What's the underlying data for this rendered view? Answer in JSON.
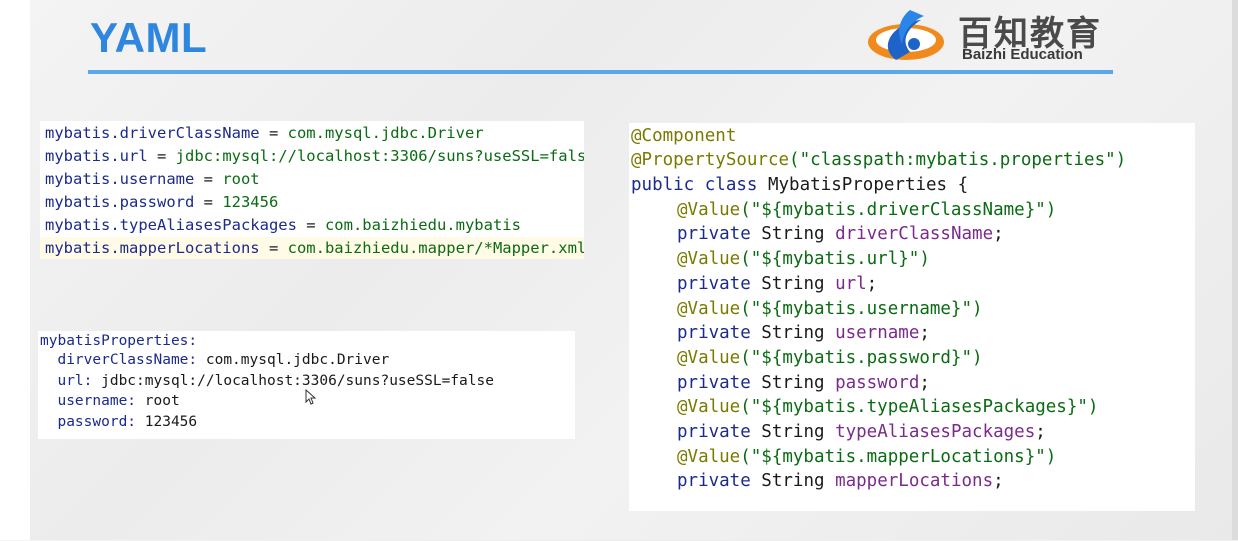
{
  "slide": {
    "title": "YAML"
  },
  "logo": {
    "name_cn": "百知教育",
    "name_en": "Baizhi Education"
  },
  "properties_file": {
    "lines": [
      {
        "key": "mybatis.driverClassName",
        "sep": " = ",
        "value": "com.mysql.jdbc.Driver"
      },
      {
        "key": "mybatis.url",
        "sep": " = ",
        "value": "jdbc:mysql://localhost:3306/suns?useSSL=fals"
      },
      {
        "key": "mybatis.username",
        "sep": " = ",
        "value": "root"
      },
      {
        "key": "mybatis.password",
        "sep": " = ",
        "value": "123456"
      },
      {
        "key": "mybatis.typeAliasesPackages",
        "sep": " = ",
        "value": "com.baizhiedu.mybatis"
      },
      {
        "key": "mybatis.mapperLocations",
        "sep": " = ",
        "value": "com.baizhiedu.mapper/*Mapper.xml"
      }
    ]
  },
  "yaml_file": {
    "root": "mybatisProperties:",
    "entries": [
      {
        "key": "  dirverClassName:",
        "value": " com.mysql.jdbc.Driver"
      },
      {
        "key": "  url:",
        "value": " jdbc:mysql://localhost:3306/suns?useSSL=false"
      },
      {
        "key": "  username:",
        "value": " root"
      },
      {
        "key": "  password:",
        "value": " 123456"
      }
    ]
  },
  "java_code": {
    "annotation_component": "@Component",
    "annotation_property_source": "@PropertySource",
    "property_source_arg": "(\"classpath:mybatis.properties\")",
    "class_decl_kw": "public class",
    "class_name": " MybatisProperties {",
    "fields": [
      {
        "value_ann": "@Value",
        "value_arg": "(\"${mybatis.driverClassName}\")",
        "decl_kw": "private",
        "type": " String ",
        "name": "driverClassName",
        "end": ";"
      },
      {
        "value_ann": "@Value",
        "value_arg": "(\"${mybatis.url}\")",
        "decl_kw": "private",
        "type": " String ",
        "name": "url",
        "end": ";"
      },
      {
        "value_ann": "@Value",
        "value_arg": "(\"${mybatis.username}\")",
        "decl_kw": "private",
        "type": " String ",
        "name": "username",
        "end": ";"
      },
      {
        "value_ann": "@Value",
        "value_arg": "(\"${mybatis.password}\")",
        "decl_kw": "private",
        "type": " String ",
        "name": "password",
        "end": ";"
      },
      {
        "value_ann": "@Value",
        "value_arg": "(\"${mybatis.typeAliasesPackages}\")",
        "decl_kw": "private",
        "type": " String ",
        "name": "typeAliasesPackages",
        "end": ";"
      },
      {
        "value_ann": "@Value",
        "value_arg": "(\"${mybatis.mapperLocations}\")",
        "decl_kw": "private",
        "type": " String ",
        "name": "mapperLocations",
        "end": ";"
      }
    ]
  },
  "colors": {
    "title_blue": "#2e86de",
    "rule_blue": "#5aa8ec",
    "keyword": "#1b2a8c",
    "string": "#0a6b12",
    "annotation": "#7a7a00",
    "field": "#7a2a8c"
  }
}
